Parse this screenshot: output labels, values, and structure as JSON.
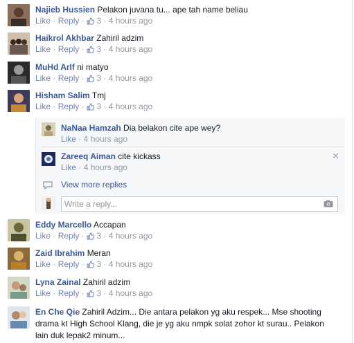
{
  "labels": {
    "like": "Like",
    "reply": "Reply",
    "sep": "·"
  },
  "comments_top": [
    {
      "name": "Najieb Hussien",
      "text": "Pelakon juvana tu... ape tah name beliau",
      "likes": "3",
      "time": "4 hours ago"
    },
    {
      "name": "Haikrol Akhbar",
      "text": "Zahiril adzim",
      "likes": "3",
      "time": "4 hours ago"
    },
    {
      "name": "MuHd ArIf",
      "text": "ni matyo",
      "likes": "3",
      "time": "4 hours ago"
    },
    {
      "name": "Hisham Salim",
      "text": "Tmj",
      "likes": "3",
      "time": "4 hours ago"
    }
  ],
  "replies": [
    {
      "name": "NaNaa Hamzah",
      "text": "Dia belakon cite ape wey?",
      "time": "4 hours ago"
    },
    {
      "name": "Zareeq Aiman",
      "text": "cite kickass",
      "time": "4 hours ago"
    }
  ],
  "reply_actions": {
    "view_more": "View more replies",
    "placeholder": "Write a reply...",
    "close_glyph": "✕"
  },
  "comments_bottom": [
    {
      "name": "Eddy Marcello",
      "text": "Accapan",
      "likes": "3",
      "time": "4 hours ago"
    },
    {
      "name": "Zaid Ibrahim",
      "text": "Meran",
      "likes": "3",
      "time": "4 hours ago"
    },
    {
      "name": "Lyna Zainal",
      "text": "Zahiril adzim",
      "likes": "3",
      "time": "4 hours ago"
    }
  ],
  "last_comment": {
    "name": "En Che Qie",
    "line1": "Zahiril Adzim... Die antara pelakon yg aku respek... Mse shooting",
    "line2": "drama kt High School Klang, die je yg aku nmpk solat zohor kt surau.. Pelakon",
    "line3": "lain duk lepak2 minum..."
  },
  "colors": {
    "link": "#3b5998",
    "meta": "#9197a3",
    "reply_bg": "#f6f7f9"
  },
  "icons": {
    "like": "thumbs-up-icon",
    "view_more": "comment-bubble-icon",
    "attach": "camera-icon",
    "close": "close-icon"
  }
}
